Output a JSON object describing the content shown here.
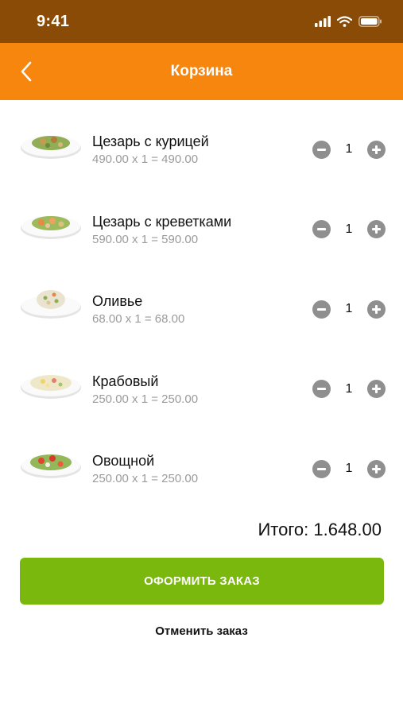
{
  "status_bar": {
    "time": "9:41"
  },
  "header": {
    "title": "Корзина",
    "back_icon": "chevron-left-icon"
  },
  "cart": {
    "items": [
      {
        "name": "Цезарь с курицей",
        "calc": "490.00 x 1 = 490.00",
        "qty": "1"
      },
      {
        "name": "Цезарь с креветками",
        "calc": "590.00 x 1 = 590.00",
        "qty": "1"
      },
      {
        "name": "Оливье",
        "calc": "68.00 x 1 = 68.00",
        "qty": "1"
      },
      {
        "name": "Крабовый",
        "calc": "250.00 x 1 = 250.00",
        "qty": "1"
      },
      {
        "name": "Овощной",
        "calc": "250.00 x 1 = 250.00",
        "qty": "1"
      }
    ],
    "total_label": "Итого: 1.648.00"
  },
  "actions": {
    "checkout_label": "ОФОРМИТЬ ЗАКАЗ",
    "cancel_label": "Отменить заказ"
  },
  "colors": {
    "status_bar": "#8a4b06",
    "header": "#f7860f",
    "checkout": "#7ab80e",
    "qty_button": "#8f8f8f",
    "secondary_text": "#9b9b9b"
  }
}
